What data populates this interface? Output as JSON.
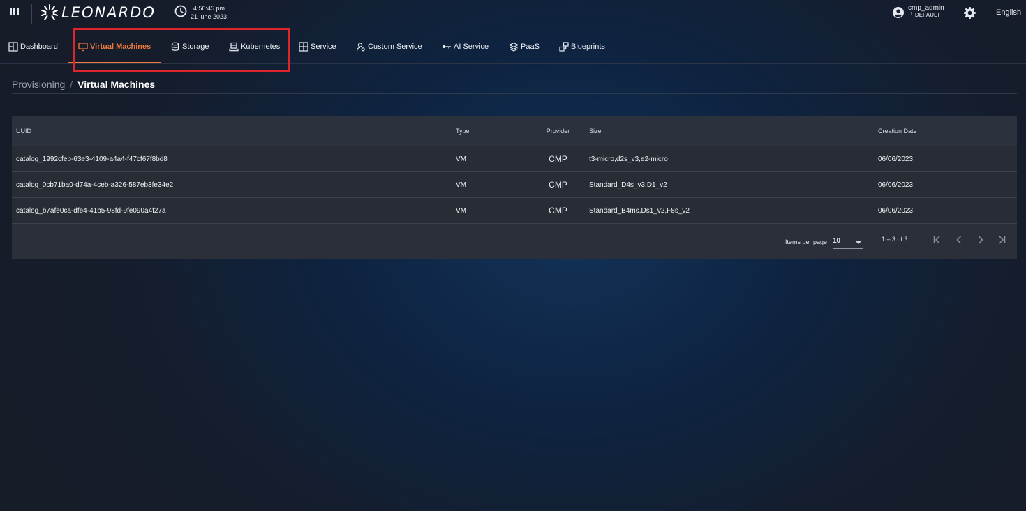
{
  "header": {
    "logo_text": "LEONARDO",
    "time": "4:56:45 pm",
    "date": "21 june 2023",
    "user_name": "cmp_admin",
    "user_role": "└ DEFAULT",
    "language": "English"
  },
  "nav": {
    "tabs": [
      {
        "label": "Dashboard",
        "icon": "dashboard-icon"
      },
      {
        "label": "Virtual Machines",
        "icon": "monitor-icon",
        "active": true
      },
      {
        "label": "Storage",
        "icon": "database-icon"
      },
      {
        "label": "Kubernetes",
        "icon": "server-icon"
      },
      {
        "label": "Service",
        "icon": "grid-icon"
      },
      {
        "label": "Custom Service",
        "icon": "custom-service-icon"
      },
      {
        "label": "AI Service",
        "icon": "ai-key-icon"
      },
      {
        "label": "PaaS",
        "icon": "layers-icon"
      },
      {
        "label": "Blueprints",
        "icon": "blueprint-icon"
      }
    ],
    "active_color": "#f07a3c",
    "highlight_color": "#e0242c"
  },
  "breadcrumb": {
    "parent": "Provisioning",
    "separator": "/",
    "current": "Virtual Machines"
  },
  "table": {
    "columns": [
      "UUID",
      "Type",
      "Provider",
      "Size",
      "Creation Date"
    ],
    "rows": [
      {
        "uuid": "catalog_1992cfeb-63e3-4109-a4a4-f47cf67f8bd8",
        "type": "VM",
        "provider": "CMP",
        "size": "t3-micro,d2s_v3,e2-micro",
        "date": "06/06/2023"
      },
      {
        "uuid": "catalog_0cb71ba0-d74a-4ceb-a326-587eb3fe34e2",
        "type": "VM",
        "provider": "CMP",
        "size": "Standard_D4s_v3,D1_v2",
        "date": "06/06/2023"
      },
      {
        "uuid": "catalog_b7afe0ca-dfe4-41b5-98fd-9fe090a4f27a",
        "type": "VM",
        "provider": "CMP",
        "size": "Standard_B4ms,Ds1_v2,F8s_v2",
        "date": "06/06/2023"
      }
    ]
  },
  "pagination": {
    "items_per_page_label": "Items per page",
    "items_per_page_value": "10",
    "range": "1 – 3 of 3"
  }
}
